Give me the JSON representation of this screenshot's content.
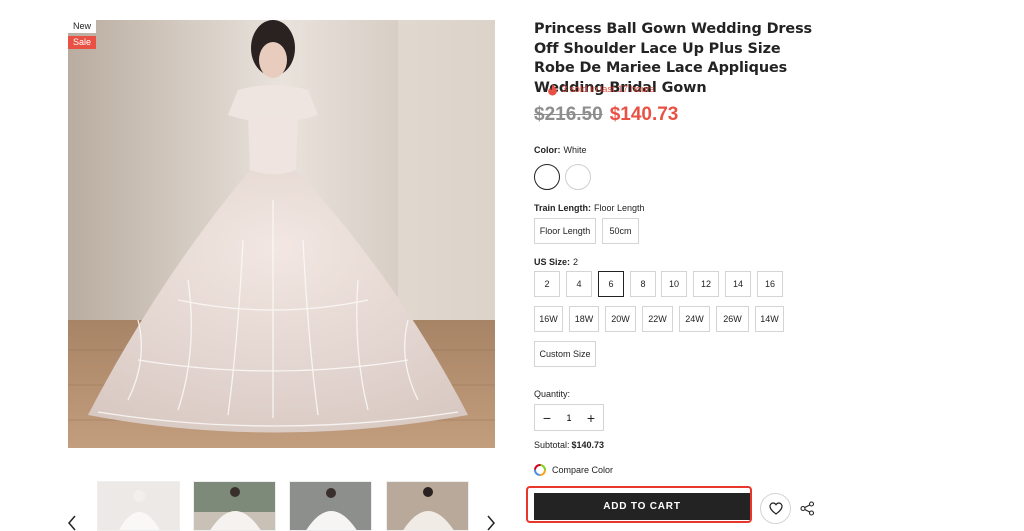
{
  "badges": {
    "new": "New",
    "sale": "Sale"
  },
  "product": {
    "title": "Princess Ball Gown Wedding Dress Off Shoulder Lace Up Plus Size Robe De Mariee Lace Appliques Wedding Bridal Gown",
    "sold_text": "3 sold in last 17 hours",
    "price_old": "$216.50",
    "price_new": "$140.73"
  },
  "color": {
    "label": "Color:",
    "value": "White",
    "swatches": [
      "White",
      "Ivory"
    ]
  },
  "train": {
    "label": "Train Length:",
    "value": "Floor Length",
    "options": [
      "Floor Length",
      "50cm"
    ]
  },
  "size": {
    "label": "US Size:",
    "value": "2",
    "options": [
      "2",
      "4",
      "6",
      "8",
      "10",
      "12",
      "14",
      "16",
      "16W",
      "18W",
      "20W",
      "22W",
      "24W",
      "26W",
      "14W",
      "Custom Size"
    ]
  },
  "quantity": {
    "label": "Quantity:",
    "value": "1",
    "minus": "−",
    "plus": "+"
  },
  "subtotal": {
    "label": "Subtotal:",
    "value": "$140.73"
  },
  "compare": {
    "label": "Compare Color"
  },
  "actions": {
    "add_to_cart": "ADD TO CART"
  },
  "colors": {
    "accent": "#e95144",
    "dark": "#232323",
    "highlight": "#e8362c"
  },
  "icons": [
    "fire-icon",
    "compare-color-icon",
    "heart-icon",
    "share-icon",
    "chevron-left-icon",
    "chevron-right-icon"
  ]
}
